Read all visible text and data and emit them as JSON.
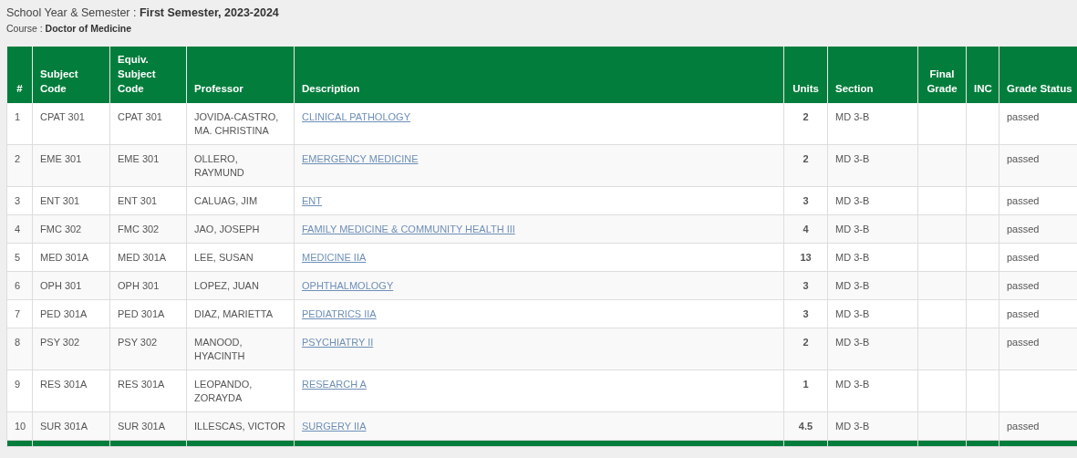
{
  "summary": {
    "semester_line": "School Year & Semester : **First Semester, 2023-2024**",
    "course_line": "Course : **Doctor of Medicine**"
  },
  "table": {
    "columns": [
      "#",
      "Subject Code",
      "Equiv. Subject Code",
      "Professor",
      "Description",
      "Units",
      "Section",
      "Final Grade",
      "INC",
      "Grade Status"
    ],
    "rows": [
      {
        "number": "1",
        "subject_code": "CPAT 301",
        "equiv_code": "CPAT 301",
        "professor": "JOVIDA-CASTRO, MA. CHRISTINA",
        "description": "CLINICAL PATHOLOGY",
        "units": "2",
        "section": "MD 3-B",
        "grade_status": "passed"
      },
      {
        "number": "2",
        "subject_code": "EME 301",
        "equiv_code": "EME 301",
        "professor": "OLLERO, RAYMUND",
        "description": "EMERGENCY MEDICINE",
        "units": "2",
        "section": "MD 3-B",
        "grade_status": "passed"
      },
      {
        "number": "3",
        "subject_code": "ENT 301",
        "equiv_code": "ENT 301",
        "professor": "CALUAG, JIM",
        "description": "ENT",
        "units": "3",
        "section": "MD 3-B",
        "grade_status": "passed"
      },
      {
        "number": "4",
        "subject_code": "FMC 302",
        "equiv_code": "FMC 302",
        "professor": "JAO, JOSEPH",
        "description": "FAMILY MEDICINE & COMMUNITY HEALTH III",
        "units": "4",
        "section": "MD 3-B",
        "grade_status": "passed"
      },
      {
        "number": "5",
        "subject_code": "MED 301A",
        "equiv_code": "MED 301A",
        "professor": "LEE, SUSAN",
        "description": "MEDICINE IIA",
        "units": "13",
        "section": "MD 3-B",
        "grade_status": "passed"
      },
      {
        "number": "6",
        "subject_code": "OPH 301",
        "equiv_code": "OPH 301",
        "professor": "LOPEZ, JUAN",
        "description": "OPHTHALMOLOGY",
        "units": "3",
        "section": "MD 3-B",
        "grade_status": "passed"
      },
      {
        "number": "7",
        "subject_code": "PED 301A",
        "equiv_code": "PED 301A",
        "professor": "DIAZ, MARIETTA",
        "description": "PEDIATRICS IIA",
        "units": "3",
        "section": "MD 3-B",
        "grade_status": "passed"
      },
      {
        "number": "8",
        "subject_code": "PSY 302",
        "equiv_code": "PSY 302",
        "professor": "MANOOD, HYACINTH",
        "description": "PSYCHIATRY II",
        "units": "2",
        "section": "MD 3-B",
        "grade_status": "passed"
      },
      {
        "number": "9",
        "subject_code": "RES 301A",
        "equiv_code": "RES 301A",
        "professor": "LEOPANDO, ZORAYDA",
        "description": "RESEARCH A",
        "units": "1",
        "section": "MD 3-B"
      },
      {
        "number": "10",
        "subject_code": "SUR 301A",
        "equiv_code": "SUR 301A",
        "professor": "ILLESCAS, VICTOR",
        "description": "SURGERY IIA",
        "units": "4.5",
        "section": "MD 3-B",
        "grade_status": "passed"
      }
    ]
  }
}
